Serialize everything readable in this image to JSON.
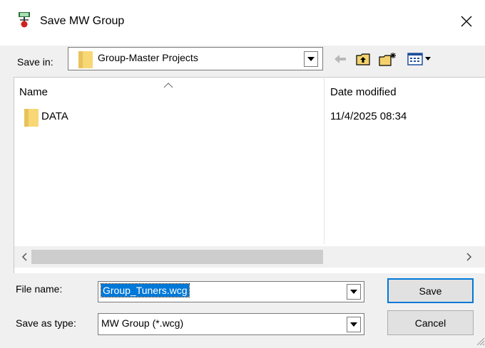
{
  "window": {
    "title": "Save MW Group",
    "app_icon": "ant-tower-icon",
    "close_icon": "close-icon"
  },
  "save_in": {
    "label": "Save in:",
    "value": "Group-Master Projects"
  },
  "toolbar": {
    "back_icon": "back-arrow-icon",
    "up_icon": "up-folder-icon",
    "new_folder_icon": "new-folder-icon",
    "view_icon": "view-menu-icon"
  },
  "file_list": {
    "columns": [
      "Name",
      "Date modified"
    ],
    "rows": [
      {
        "name": "DATA",
        "date": "11/4/2025 08:34",
        "icon": "folder-icon"
      }
    ]
  },
  "file_name": {
    "label": "File name:",
    "value": "Group_Tuners.wcg"
  },
  "save_as_type": {
    "label": "Save as type:",
    "value": "MW Group (*.wcg)"
  },
  "buttons": {
    "save": "Save",
    "cancel": "Cancel"
  },
  "colors": {
    "selection": "#0078d7",
    "window_bg": "#f0f0f0",
    "folder": "#f8d775"
  }
}
